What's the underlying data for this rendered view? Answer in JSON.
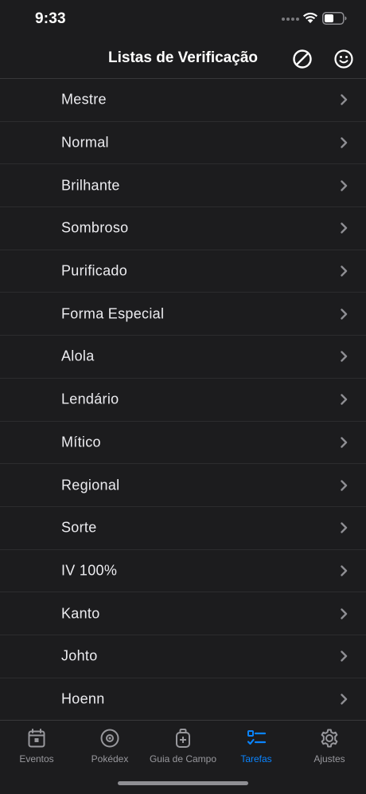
{
  "status_bar": {
    "time": "9:33"
  },
  "nav": {
    "title": "Listas de Verificação",
    "left_icon": "no-entry-icon",
    "right_icon": "smiley-icon"
  },
  "list": {
    "items": [
      {
        "label": "Mestre"
      },
      {
        "label": "Normal"
      },
      {
        "label": "Brilhante"
      },
      {
        "label": "Sombroso"
      },
      {
        "label": "Purificado"
      },
      {
        "label": "Forma Especial"
      },
      {
        "label": "Alola"
      },
      {
        "label": "Lendário"
      },
      {
        "label": "Mítico"
      },
      {
        "label": "Regional"
      },
      {
        "label": "Sorte"
      },
      {
        "label": "IV 100%"
      },
      {
        "label": "Kanto"
      },
      {
        "label": "Johto"
      },
      {
        "label": "Hoenn"
      }
    ]
  },
  "tabs": [
    {
      "label": "Eventos",
      "icon": "calendar-icon"
    },
    {
      "label": "Pokédex",
      "icon": "pokeball-icon"
    },
    {
      "label": "Guia de Campo",
      "icon": "backpack-icon"
    },
    {
      "label": "Tarefas",
      "icon": "checklist-icon",
      "active": true
    },
    {
      "label": "Ajustes",
      "icon": "gear-icon"
    }
  ],
  "colors": {
    "background": "#1c1c1e",
    "accent": "#0a84ff",
    "inactive": "#98989d"
  }
}
